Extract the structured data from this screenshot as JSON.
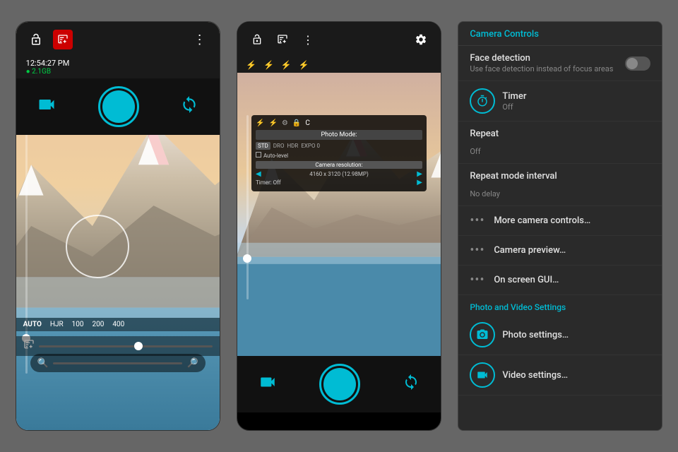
{
  "app": {
    "background_color": "#666666"
  },
  "phone1": {
    "header": {
      "icons": [
        "lock-open-icon",
        "exposure-icon",
        "more-icon"
      ],
      "exposure_label": "⊞"
    },
    "status": {
      "time": "12:54:27 PM",
      "storage": "● 2.1GB"
    },
    "iso_options": [
      "AUTO",
      "HJR",
      "100",
      "200",
      "400"
    ],
    "iso_active": "AUTO",
    "footer": {
      "video_icon": "🎥",
      "shutter_label": "📷",
      "rotate_icon": "🔄"
    }
  },
  "phone2": {
    "header": {
      "icons": [
        "lock-open-icon",
        "exposure-icon",
        "more-icon",
        "gear-icon"
      ]
    },
    "photo_mode_overlay": {
      "header": "Photo Mode:",
      "auto_level_label": "Auto-level",
      "resolution_header": "Camera resolution:",
      "resolution_value": "4160 x 3120 (12.98MP)",
      "timer_label": "Timer: Off"
    },
    "modes": [
      "STD",
      "DRO",
      "HDR",
      "EXPO 0"
    ],
    "footer": {
      "video_icon": "🎥",
      "shutter_label": "📷",
      "rotate_icon": "🔄"
    }
  },
  "settings": {
    "header": "Camera Controls",
    "items": [
      {
        "id": "face-detection",
        "label": "Face detection",
        "sublabel": "Use face detection instead of focus areas",
        "type": "toggle",
        "toggle_value": false,
        "icon": null
      },
      {
        "id": "timer",
        "label": "Timer",
        "sublabel": "Off",
        "type": "icon",
        "icon": "⏱"
      },
      {
        "id": "repeat",
        "label": "Repeat",
        "sublabel": "Off",
        "type": "text-only"
      },
      {
        "id": "repeat-mode-interval",
        "label": "Repeat mode interval",
        "sublabel": "No delay",
        "type": "text-only"
      },
      {
        "id": "more-camera-controls",
        "label": "More camera controls…",
        "type": "dots"
      },
      {
        "id": "camera-preview",
        "label": "Camera preview…",
        "type": "dots"
      },
      {
        "id": "on-screen-gui",
        "label": "On screen GUI…",
        "type": "dots"
      }
    ],
    "photo_video_section": "Photo and Video Settings",
    "photo_video_items": [
      {
        "id": "photo-settings",
        "label": "Photo settings…",
        "icon": "📷",
        "icon_type": "camera"
      },
      {
        "id": "video-settings",
        "label": "Video settings…",
        "icon": "🎥",
        "icon_type": "video"
      }
    ]
  }
}
